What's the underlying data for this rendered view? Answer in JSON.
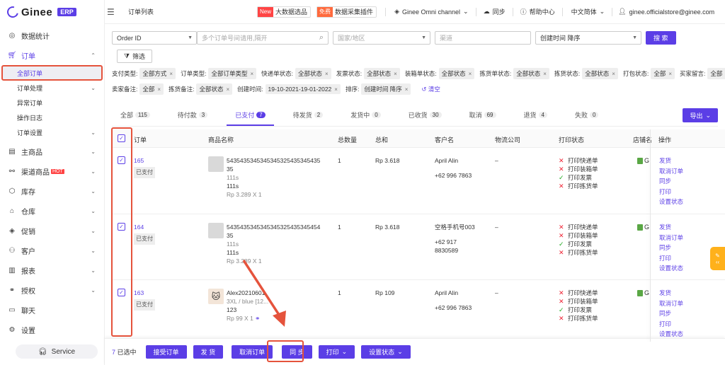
{
  "app": {
    "name": "Ginee",
    "badge": "ERP"
  },
  "sidebar": {
    "items": [
      {
        "label": "数据统计",
        "icon": "dashboard-icon"
      },
      {
        "label": "订单",
        "icon": "cart-icon"
      },
      {
        "label": "主商品",
        "icon": "product-icon"
      },
      {
        "label": "渠道商品",
        "icon": "channel-icon",
        "hot": "HOT"
      },
      {
        "label": "库存",
        "icon": "box-icon"
      },
      {
        "label": "仓库",
        "icon": "warehouse-icon"
      },
      {
        "label": "促销",
        "icon": "tag-icon"
      },
      {
        "label": "客户",
        "icon": "users-icon"
      },
      {
        "label": "报表",
        "icon": "chart-icon"
      },
      {
        "label": "授权",
        "icon": "link-icon"
      },
      {
        "label": "聊天",
        "icon": "chat-icon"
      },
      {
        "label": "设置",
        "icon": "gear-icon"
      }
    ],
    "order_sub": [
      "全部订单",
      "订单处理",
      "异常订单",
      "操作日志",
      "订单设置"
    ],
    "service": "Service"
  },
  "topbar": {
    "page_title": "订单列表",
    "promo1_tag": "New",
    "promo1_label": "大数据选品",
    "promo2_tag": "免费",
    "promo2_label": "数据采集插件",
    "channel": "Ginee Omni channel",
    "sync": "同步",
    "help": "帮助中心",
    "language": "中文简体",
    "user": "ginee.officialstore@ginee.com"
  },
  "filters": {
    "order_id_select": "Order ID",
    "search_placeholder": "多个订单号间请用,隔开",
    "country_placeholder": "国家/地区",
    "channel_placeholder": "渠道",
    "sort_select": "创建时间 降序",
    "search_button": "搜 索",
    "filter_button": "筛选"
  },
  "chips": {
    "row1": [
      {
        "label": "支付类型:",
        "value": "全部方式"
      },
      {
        "label": "订单类型:",
        "value": "全部订单类型"
      },
      {
        "label": "快递单状态:",
        "value": "全部状态"
      },
      {
        "label": "发票状态:",
        "value": "全部状态"
      },
      {
        "label": "装箱单状态:",
        "value": "全部状态"
      },
      {
        "label": "拣货单状态:",
        "value": "全部状态"
      },
      {
        "label": "拣货状态:",
        "value": "全部状态"
      },
      {
        "label": "打包状态:",
        "value": "全部"
      },
      {
        "label": "买家留言:",
        "value": "全部"
      }
    ],
    "row2": [
      {
        "label": "卖家备注:",
        "value": "全部"
      },
      {
        "label": "拣货备注:",
        "value": "全部状态"
      },
      {
        "label": "创建时间:",
        "value": "19-10-2021-19-01-2022"
      },
      {
        "label": "排序:",
        "value": "创建时间 降序"
      }
    ],
    "clear": "清空"
  },
  "tabs": [
    {
      "label": "全部",
      "count": "115"
    },
    {
      "label": "待付款",
      "count": "3"
    },
    {
      "label": "已支付",
      "count": "7"
    },
    {
      "label": "待发货",
      "count": "2"
    },
    {
      "label": "发货中",
      "count": "0"
    },
    {
      "label": "已收货",
      "count": "30"
    },
    {
      "label": "取消",
      "count": "69"
    },
    {
      "label": "退货",
      "count": "4"
    },
    {
      "label": "失败",
      "count": "0"
    }
  ],
  "export_button": "导出",
  "table": {
    "headers": {
      "order": "订单",
      "product": "商品名称",
      "qty": "总数量",
      "total": "总和",
      "customer": "客户名",
      "logistics": "物流公司",
      "print": "打印状态",
      "shop": "店铺名",
      "ops": "操作"
    },
    "rows": [
      {
        "order_no": "165",
        "status": "已支付",
        "product_name_1": "5435435345345345325435345435",
        "product_name_2": "35",
        "variant": "111s",
        "sku": "111s",
        "price": "Rp 3.289 X 1",
        "qty": "1",
        "total": "Rp 3.618",
        "customer": "April Alin",
        "phone": "+62 996 7863",
        "phone2": "",
        "logistics": "–",
        "print": [
          {
            "ok": false,
            "label": "打印快递单"
          },
          {
            "ok": false,
            "label": "打印装箱单"
          },
          {
            "ok": true,
            "label": "打印发票"
          },
          {
            "ok": false,
            "label": "打印拣货单"
          }
        ],
        "shop": "G",
        "ops": [
          "发货",
          "取消订单",
          "同步",
          "打印",
          "设置状态"
        ]
      },
      {
        "order_no": "164",
        "status": "已支付",
        "product_name_1": "5435435345345345325435345454",
        "product_name_2": "35",
        "variant": "111s",
        "sku": "111s",
        "price": "Rp 3.289 X 1",
        "qty": "1",
        "total": "Rp 3.618",
        "customer": "空格手机号003",
        "phone": "+62 917",
        "phone2": "8830589",
        "logistics": "–",
        "print": [
          {
            "ok": false,
            "label": "打印快递单"
          },
          {
            "ok": false,
            "label": "打印装箱单"
          },
          {
            "ok": true,
            "label": "打印发票"
          },
          {
            "ok": false,
            "label": "打印拣货单"
          }
        ],
        "shop": "G",
        "ops": [
          "发货",
          "取消订单",
          "同步",
          "打印",
          "设置状态"
        ]
      },
      {
        "order_no": "163",
        "status": "已支付",
        "product_name_1": "Alex2021060‌1",
        "product_name_2": "",
        "variant": "3XL / blue [12...",
        "sku": "123",
        "price": "Rp 99 X 1",
        "qty": "1",
        "total": "Rp 109",
        "customer": "April Alin",
        "phone": "+62 996 7863",
        "phone2": "",
        "logistics": "–",
        "print": [
          {
            "ok": false,
            "label": "打印快递单"
          },
          {
            "ok": false,
            "label": "打印装箱单"
          },
          {
            "ok": true,
            "label": "打印发票"
          },
          {
            "ok": false,
            "label": "打印拣货单"
          }
        ],
        "shop": "G",
        "ops": [
          "发货",
          "取消订单",
          "同步",
          "打印",
          "设置状态"
        ]
      }
    ]
  },
  "bottom": {
    "selected_count": "7",
    "selected_suffix": "已选中",
    "accept": "接受订单",
    "ship": "发 货",
    "cancel": "取消订单",
    "sync": "同 步",
    "print": "打印",
    "set_status": "设置状态"
  },
  "colors": {
    "primary": "#5b3ee6",
    "highlight": "#e5533c",
    "hot": "#ff4444"
  }
}
